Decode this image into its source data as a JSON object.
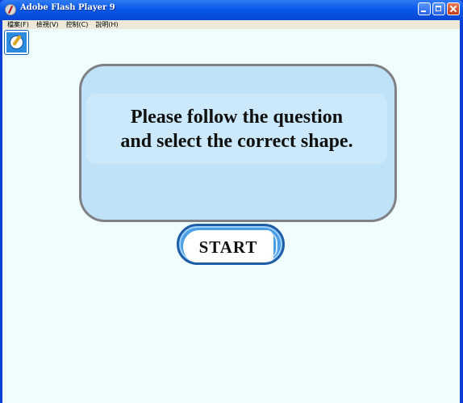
{
  "window": {
    "title": "Adobe Flash Player 9",
    "icon": "flash-player-icon",
    "controls": [
      "minimize-icon",
      "maximize-icon",
      "close-icon"
    ]
  },
  "menubar": {
    "items": [
      {
        "label": "檔案(F)"
      },
      {
        "label": "檢視(V)"
      },
      {
        "label": "控制(C)"
      },
      {
        "label": "說明(H)"
      }
    ]
  },
  "content": {
    "badge_icon": "pencil-circle-icon",
    "message_lines": [
      "Please follow the question",
      "and select the correct shape."
    ],
    "start_label": "START"
  },
  "colors": {
    "titlebar": "#0a58e8",
    "background": "#f0fdfd",
    "panel_fill": "#bfe2f8",
    "panel_border": "#7f8186",
    "start_border": "#1e5ea8"
  }
}
